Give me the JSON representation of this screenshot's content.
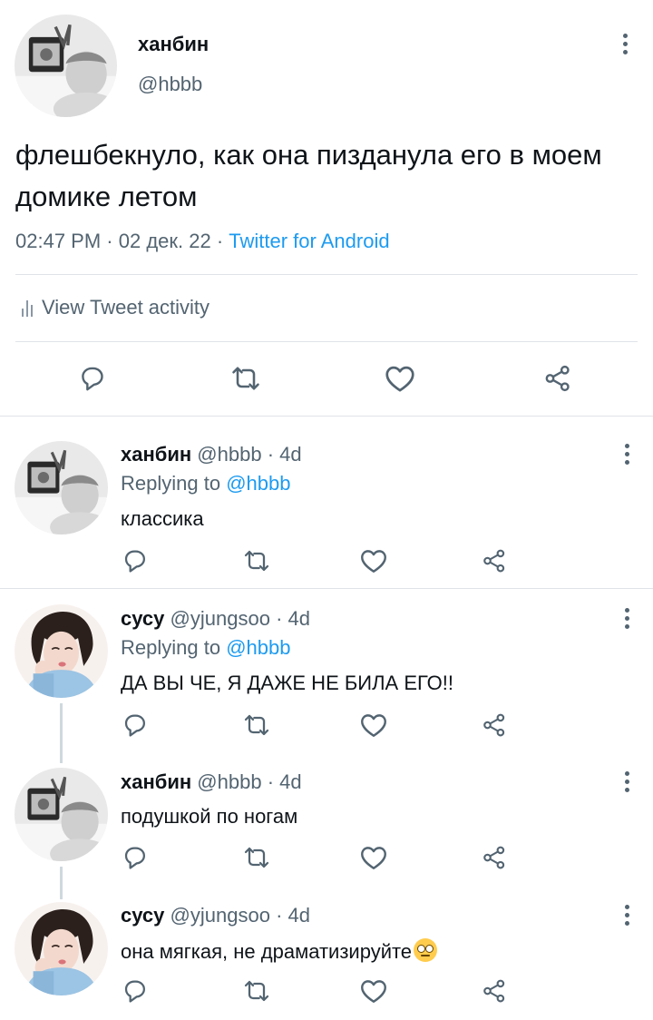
{
  "main_tweet": {
    "name": "ханбин",
    "handle": "@hbbb",
    "text": "флешбекнуло, как она пизданула его в моем домике летом",
    "time": "02:47 PM",
    "date": "02 дек. 22",
    "source": "Twitter for Android",
    "activity_label": "View Tweet activity"
  },
  "replies": [
    {
      "name": "ханбин",
      "handle": "@hbbb",
      "age": "4d",
      "replying_label": "Replying to",
      "replying_to": "@hbbb",
      "text": "классика",
      "avatar": "hanbin"
    },
    {
      "name": "сусу",
      "handle": "@yjungsoo",
      "age": "4d",
      "replying_label": "Replying to",
      "replying_to": "@hbbb",
      "text": "ДА ВЫ ЧЕ, Я ДАЖЕ НЕ БИЛА ЕГО!!",
      "avatar": "susu"
    },
    {
      "name": "ханбин",
      "handle": "@hbbb",
      "age": "4d",
      "text": "подушкой по ногам",
      "avatar": "hanbin"
    },
    {
      "name": "сусу",
      "handle": "@yjungsoo",
      "age": "4d",
      "text": "она мягкая, не драматизируйте",
      "emoji": "face-with-rolling-eyes",
      "avatar": "susu"
    }
  ],
  "icons": {
    "reply": "reply-icon",
    "retweet": "retweet-icon",
    "like": "heart-icon",
    "share": "share-icon",
    "more": "more-vertical-icon",
    "activity": "bar-chart-icon"
  },
  "colors": {
    "link": "#1d9bf0",
    "secondary_text": "#536471",
    "icon": "#536471",
    "divider": "#dfe3e7"
  }
}
